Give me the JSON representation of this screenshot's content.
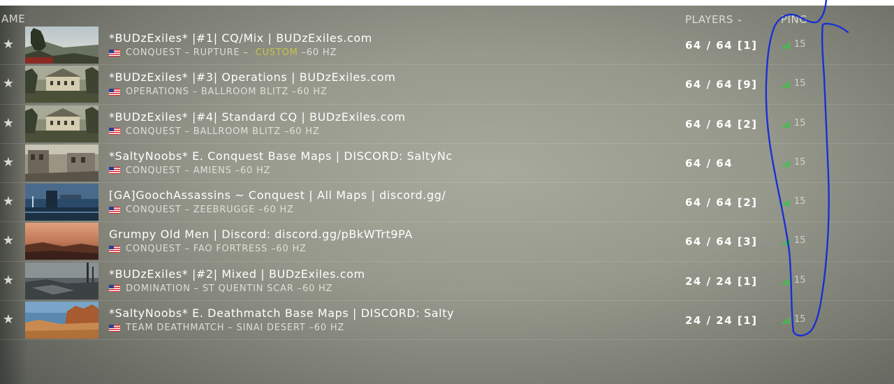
{
  "header": {
    "name_label": "AME",
    "players_label": "PLAYERS",
    "ping_label": "PING"
  },
  "servers": [
    {
      "title": "*BUDzExiles* |#1| CQ/Mix | BUDzExiles.com",
      "mode": "CONQUEST",
      "map": "RUPTURE",
      "tag": "CUSTOM",
      "rate": "60 HZ",
      "players": "64 / 64 [1]",
      "ping": "15",
      "thumb": "forest-ridge"
    },
    {
      "title": "*BUDzExiles* |#3| Operations | BUDzExiles.com",
      "mode": "OPERATIONS",
      "map": "BALLROOM BLITZ",
      "tag": "",
      "rate": "60 HZ",
      "players": "64 / 64 [9]",
      "ping": "15",
      "thumb": "chateau"
    },
    {
      "title": "*BUDzExiles* |#4| Standard CQ | BUDzExiles.com",
      "mode": "CONQUEST",
      "map": "BALLROOM BLITZ",
      "tag": "",
      "rate": "60 HZ",
      "players": "64 / 64 [2]",
      "ping": "15",
      "thumb": "chateau"
    },
    {
      "title": "*SaltyNoobs* E. Conquest Base Maps | DISCORD: SaltyNc",
      "mode": "CONQUEST",
      "map": "AMIENS",
      "tag": "",
      "rate": "60 HZ",
      "players": "64 / 64",
      "ping": "15",
      "thumb": "town-street"
    },
    {
      "title": "[GA]GoochAssassins ~ Conquest | All Maps | discord.gg/",
      "mode": "CONQUEST",
      "map": "ZEEBRUGGE",
      "tag": "",
      "rate": "60 HZ",
      "players": "64 / 64 [2]",
      "ping": "15",
      "thumb": "harbor-night"
    },
    {
      "title": "Grumpy Old Men | Discord: discord.gg/pBkWTrt9PA",
      "mode": "CONQUEST",
      "map": "FAO FORTRESS",
      "tag": "",
      "rate": "60 HZ",
      "players": "64 / 64 [3]",
      "ping": "15",
      "thumb": "desert-dusk"
    },
    {
      "title": "*BUDzExiles* |#2| Mixed | BUDzExiles.com",
      "mode": "DOMINATION",
      "map": "ST QUENTIN SCAR",
      "tag": "",
      "rate": "60 HZ",
      "players": "24 / 24 [1]",
      "ping": "15",
      "thumb": "battlefield-grey"
    },
    {
      "title": "*SaltyNoobs* E. Deathmatch Base Maps | DISCORD: Salty",
      "mode": "TEAM DEATHMATCH",
      "map": "SINAI DESERT",
      "tag": "",
      "rate": "60 HZ",
      "players": "24 / 24 [1]",
      "ping": "15",
      "thumb": "desert-canyon"
    }
  ],
  "colors": {
    "ping_bar": "#3ec24a",
    "custom_tag": "#c9c24a",
    "annotation_ink": "#1a2fd4"
  }
}
